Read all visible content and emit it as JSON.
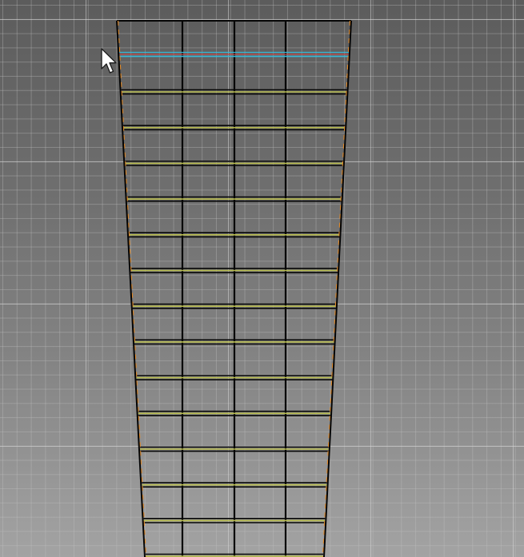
{
  "viewport": {
    "label": "",
    "background_top": "#5c5c5c",
    "background_bottom": "#a3a3a3",
    "grid_color": "#c3c3c3"
  },
  "mesh": {
    "name": "fretboard-mesh",
    "wire_color": "#050505",
    "fret_highlight_color": "#b4b84a",
    "edge_highlight_color": "#e08a2a",
    "nut_selected_color": "#3ab6d4",
    "nut_secondary_color": "#c24a4a",
    "column_count": 4,
    "fret_count": 14
  },
  "cursor": {
    "icon": "arrow-pointer-icon"
  }
}
